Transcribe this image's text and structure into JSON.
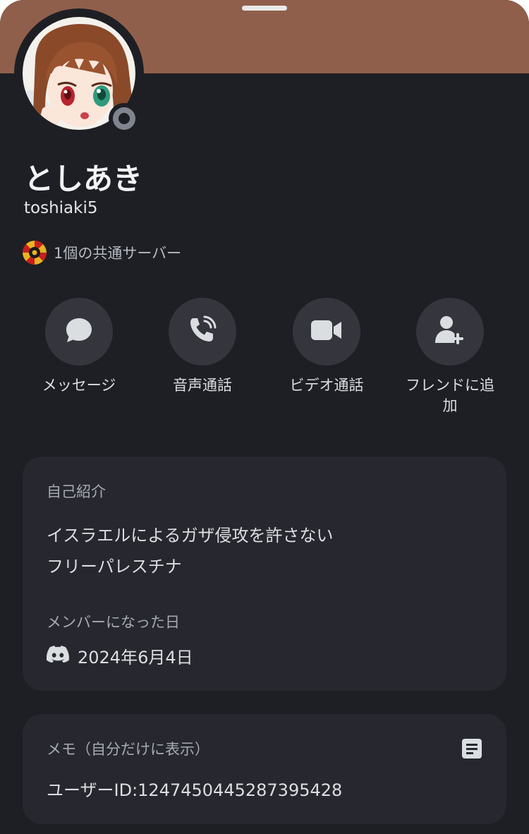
{
  "profile": {
    "display_name": "としあき",
    "username": "toshiaki5",
    "status": "offline",
    "banner_color": "#8f5f4b",
    "mutual_servers": "1個の共通サーバー"
  },
  "actions": [
    {
      "label": "メッセージ",
      "icon": "chat-bubble-icon"
    },
    {
      "label": "音声通話",
      "icon": "phone-icon"
    },
    {
      "label": "ビデオ通話",
      "icon": "video-camera-icon"
    },
    {
      "label": "フレンドに追加",
      "icon": "add-friend-icon"
    }
  ],
  "about": {
    "heading": "自己紹介",
    "bio_lines": [
      "イスラエルによるガザ侵攻を許さない",
      "フリーパレスチナ"
    ],
    "member_since_heading": "メンバーになった日",
    "member_since_date": "2024年6月4日"
  },
  "note": {
    "heading": "メモ（自分だけに表示）",
    "value": "ユーザーID:1247450445287395428"
  }
}
